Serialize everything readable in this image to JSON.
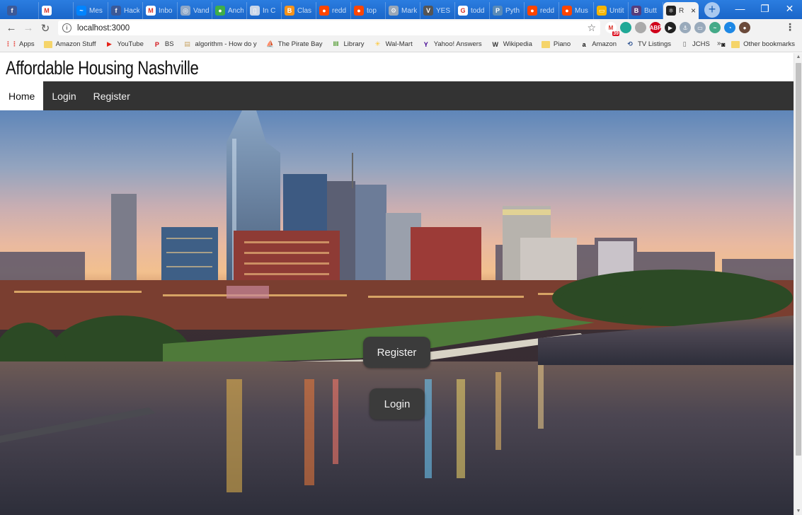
{
  "browser": {
    "tabs": [
      {
        "title": "",
        "icon": "facebook-icon",
        "color": "#3b5998",
        "glyph": "f"
      },
      {
        "title": "",
        "icon": "gmail-icon",
        "color": "#ffffff",
        "glyph": "M"
      },
      {
        "title": "Mes",
        "icon": "messenger-icon",
        "color": "#0084ff",
        "glyph": "~"
      },
      {
        "title": "Hack",
        "icon": "facebook-icon",
        "color": "#3b5998",
        "glyph": "f"
      },
      {
        "title": "Inbo",
        "icon": "gmail-icon",
        "color": "#ffffff",
        "glyph": "M"
      },
      {
        "title": "Vand",
        "icon": "globe-icon",
        "color": "#8fa8c8",
        "glyph": "◎"
      },
      {
        "title": "Anch",
        "icon": "green-circle-icon",
        "color": "#3fae49",
        "glyph": "●"
      },
      {
        "title": "In C",
        "icon": "document-icon",
        "color": "#c9d6e8",
        "glyph": "▯"
      },
      {
        "title": "Clas",
        "icon": "bitcoin-icon",
        "color": "#f7931a",
        "glyph": "B"
      },
      {
        "title": "redd",
        "icon": "reddit-icon",
        "color": "#ff4500",
        "glyph": "●"
      },
      {
        "title": "top",
        "icon": "reddit-icon",
        "color": "#ff4500",
        "glyph": "●"
      },
      {
        "title": "Mark",
        "icon": "gear-icon",
        "color": "#9aa8b8",
        "glyph": "⚙"
      },
      {
        "title": "YES",
        "icon": "letter-v-icon",
        "color": "#555555",
        "glyph": "V"
      },
      {
        "title": "todd",
        "icon": "google-icon",
        "color": "#ffffff",
        "glyph": "G"
      },
      {
        "title": "Pyth",
        "icon": "python-icon",
        "color": "#5a8bb8",
        "glyph": "P"
      },
      {
        "title": "redd",
        "icon": "reddit-icon",
        "color": "#ff4500",
        "glyph": "●"
      },
      {
        "title": "Mus",
        "icon": "reddit-icon",
        "color": "#ff4500",
        "glyph": "●"
      },
      {
        "title": "Untit",
        "icon": "slides-icon",
        "color": "#f4b400",
        "glyph": "▭"
      },
      {
        "title": "Butt",
        "icon": "bootstrap-icon",
        "color": "#563d7c",
        "glyph": "B"
      }
    ],
    "active_tab": {
      "title": "R",
      "icon": "react-icon",
      "color": "#222222",
      "glyph": "⚛"
    },
    "address": {
      "url": "localhost:3000"
    },
    "bookmarks": [
      {
        "label": "Apps",
        "icon": "apps-grid-icon",
        "color": "#e8453c",
        "glyph": "⋮⋮"
      },
      {
        "label": "Amazon Stuff",
        "icon": "folder-icon",
        "color": "#f5d46a",
        "glyph": ""
      },
      {
        "label": "YouTube",
        "icon": "youtube-icon",
        "color": "#e62117",
        "glyph": "▶"
      },
      {
        "label": "BS",
        "icon": "bs-icon",
        "color": "#d4141a",
        "glyph": "P"
      },
      {
        "label": "algorithm - How do y",
        "icon": "stackexchange-icon",
        "color": "#c8a465",
        "glyph": "▤"
      },
      {
        "label": "The Pirate Bay",
        "icon": "pirate-ship-icon",
        "color": "#222222",
        "glyph": "⛵"
      },
      {
        "label": "Library",
        "icon": "library-icon",
        "color": "#6aa84f",
        "glyph": "Ⅲ"
      },
      {
        "label": "Wal-Mart",
        "icon": "walmart-icon",
        "color": "#ffc220",
        "glyph": "✳"
      },
      {
        "label": "Yahoo! Answers",
        "icon": "yahoo-icon",
        "color": "#400090",
        "glyph": "Y"
      },
      {
        "label": "Wikipedia",
        "icon": "wikipedia-icon",
        "color": "#333333",
        "glyph": "W"
      },
      {
        "label": "Piano",
        "icon": "folder-icon",
        "color": "#f5d46a",
        "glyph": ""
      },
      {
        "label": "Amazon",
        "icon": "amazon-icon",
        "color": "#111111",
        "glyph": "a"
      },
      {
        "label": "TV Listings",
        "icon": "tv-listings-icon",
        "color": "#2a4f8f",
        "glyph": "⟲"
      },
      {
        "label": "JCHS",
        "icon": "document-icon",
        "color": "#666666",
        "glyph": "▯"
      },
      {
        "label": "",
        "icon": "camera-icon",
        "color": "#111111",
        "glyph": "◙"
      }
    ],
    "bookmarks_overflow": "»",
    "other_bookmarks": "Other bookmarks",
    "extensions": [
      {
        "icon": "gmail-checker-icon",
        "color": "#ffffff",
        "glyph": "M",
        "badge": "39"
      },
      {
        "icon": "teal-circle-icon",
        "color": "#1fa896",
        "glyph": "",
        "badge": ""
      },
      {
        "icon": "gray-square-icon",
        "color": "#aaaaaa",
        "glyph": "",
        "badge": ""
      },
      {
        "icon": "adblock-icon",
        "color": "#d0021b",
        "glyph": "ABP",
        "badge": ""
      },
      {
        "icon": "play-circle-icon",
        "color": "#222222",
        "glyph": "▶",
        "badge": ""
      },
      {
        "icon": "anchor-icon",
        "color": "#9ab",
        "glyph": "⚓",
        "badge": ""
      },
      {
        "icon": "chat-icon",
        "color": "#9ab",
        "glyph": "▭",
        "badge": ""
      },
      {
        "icon": "wave-icon",
        "color": "#4a8",
        "glyph": "~",
        "badge": ""
      },
      {
        "icon": "blue-refresh-icon",
        "color": "#1e88e5",
        "glyph": "◔",
        "badge": ""
      },
      {
        "icon": "profile-avatar-icon",
        "color": "#6b4a3a",
        "glyph": "●",
        "badge": ""
      }
    ]
  },
  "site": {
    "title": "Affordable Housing Nashville",
    "nav": [
      {
        "label": "Home",
        "active": true
      },
      {
        "label": "Login",
        "active": false
      },
      {
        "label": "Register",
        "active": false
      }
    ],
    "hero": {
      "register_label": "Register",
      "login_label": "Login"
    }
  }
}
